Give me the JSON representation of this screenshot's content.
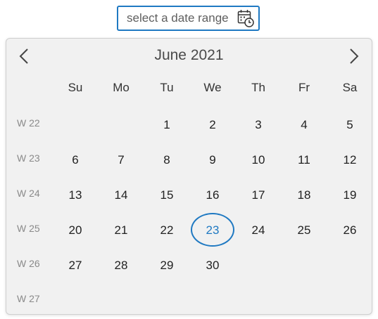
{
  "search": {
    "placeholder": "select a date range",
    "icon": "calendar-clock-icon"
  },
  "calendar": {
    "title": "June 2021",
    "prev_icon": "chevron-left-icon",
    "next_icon": "chevron-right-icon",
    "weekdays": [
      "Su",
      "Mo",
      "Tu",
      "We",
      "Th",
      "Fr",
      "Sa"
    ],
    "accent_color": "#1f79c2",
    "highlighted_day": "23",
    "weeks": [
      {
        "label": "W 22",
        "days": [
          "",
          "",
          "1",
          "2",
          "3",
          "4",
          "5"
        ]
      },
      {
        "label": "W 23",
        "days": [
          "6",
          "7",
          "8",
          "9",
          "10",
          "11",
          "12"
        ]
      },
      {
        "label": "W 24",
        "days": [
          "13",
          "14",
          "15",
          "16",
          "17",
          "18",
          "19"
        ]
      },
      {
        "label": "W 25",
        "days": [
          "20",
          "21",
          "22",
          "23",
          "24",
          "25",
          "26"
        ]
      },
      {
        "label": "W 26",
        "days": [
          "27",
          "28",
          "29",
          "30",
          "",
          "",
          ""
        ]
      },
      {
        "label": "W 27",
        "days": [
          "",
          "",
          "",
          "",
          "",
          "",
          ""
        ]
      }
    ]
  }
}
